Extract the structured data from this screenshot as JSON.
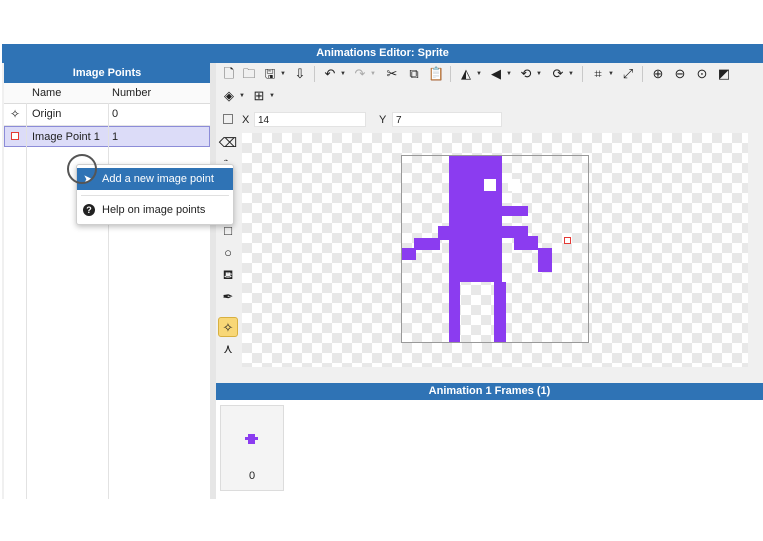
{
  "window": {
    "title": "Animations Editor: Sprite"
  },
  "image_points": {
    "title": "Image Points",
    "columns": [
      "Name",
      "Number"
    ],
    "rows": [
      {
        "name": "Origin",
        "number": "0",
        "icon": "origin-crosshair-icon"
      },
      {
        "name": "Image Point 1",
        "number": "1",
        "icon": "image-point-marker-icon"
      }
    ]
  },
  "context_menu": {
    "items": [
      {
        "label": "Add a new image point",
        "icon": "add-cursor-icon"
      },
      {
        "label": "Help on image points",
        "icon": "help-icon"
      }
    ]
  },
  "coords": {
    "x_label": "X",
    "x_value": "14",
    "y_label": "Y",
    "y_value": "7"
  },
  "frames": {
    "title": "Animation 1 Frames (1)",
    "frame_numbers": [
      "0"
    ]
  },
  "colors": {
    "accent": "#2f73b5",
    "sprite": "#8b3cf0",
    "active_tool": "#f8d777",
    "image_point_marker": "#e53935"
  }
}
